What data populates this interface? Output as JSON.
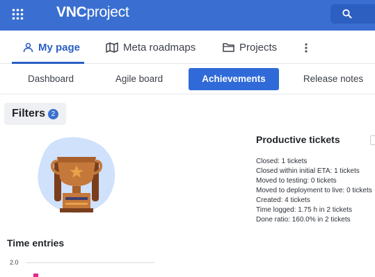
{
  "header": {
    "logo_bold": "VNC",
    "logo_rest": "project",
    "brand_color": "#3a6fd1"
  },
  "main_tabs": [
    {
      "label": "My page",
      "icon": "person-icon",
      "active": true
    },
    {
      "label": "Meta roadmaps",
      "icon": "map-icon",
      "active": false
    },
    {
      "label": "Projects",
      "icon": "folder-icon",
      "active": false
    }
  ],
  "sub_tabs": [
    {
      "label": "Dashboard",
      "active": false
    },
    {
      "label": "Agile board",
      "active": false
    },
    {
      "label": "Achievements",
      "active": true
    },
    {
      "label": "Release notes",
      "active": false
    }
  ],
  "filters": {
    "label": "Filters",
    "count": "2"
  },
  "productive": {
    "title": "Productive tickets",
    "stats": [
      "Closed: 1 tickets",
      "Closed within initial ETA: 1 tickets",
      "Moved to testing: 0 tickets",
      "Moved to deployment to live: 0 tickets",
      "Created: 4 tickets",
      "Time logged: 1.75 h in 2 tickets",
      "Done ratio: 160.0% in 2 tickets"
    ]
  },
  "time_entries": {
    "title": "Time entries",
    "y_tick": "2.0"
  }
}
